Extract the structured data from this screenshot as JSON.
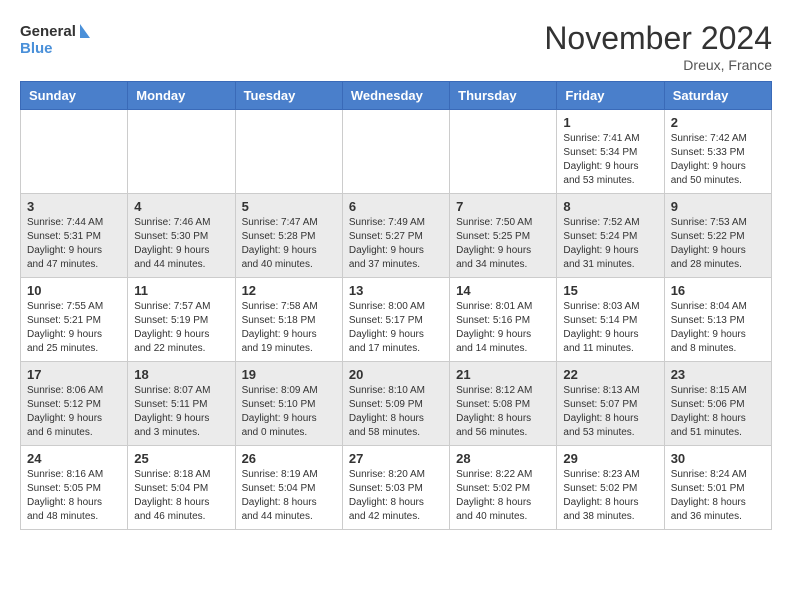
{
  "logo": {
    "line1": "General",
    "line2": "Blue"
  },
  "title": "November 2024",
  "location": "Dreux, France",
  "weekdays": [
    "Sunday",
    "Monday",
    "Tuesday",
    "Wednesday",
    "Thursday",
    "Friday",
    "Saturday"
  ],
  "weeks": [
    [
      {
        "day": "",
        "info": ""
      },
      {
        "day": "",
        "info": ""
      },
      {
        "day": "",
        "info": ""
      },
      {
        "day": "",
        "info": ""
      },
      {
        "day": "",
        "info": ""
      },
      {
        "day": "1",
        "info": "Sunrise: 7:41 AM\nSunset: 5:34 PM\nDaylight: 9 hours and 53 minutes."
      },
      {
        "day": "2",
        "info": "Sunrise: 7:42 AM\nSunset: 5:33 PM\nDaylight: 9 hours and 50 minutes."
      }
    ],
    [
      {
        "day": "3",
        "info": "Sunrise: 7:44 AM\nSunset: 5:31 PM\nDaylight: 9 hours and 47 minutes."
      },
      {
        "day": "4",
        "info": "Sunrise: 7:46 AM\nSunset: 5:30 PM\nDaylight: 9 hours and 44 minutes."
      },
      {
        "day": "5",
        "info": "Sunrise: 7:47 AM\nSunset: 5:28 PM\nDaylight: 9 hours and 40 minutes."
      },
      {
        "day": "6",
        "info": "Sunrise: 7:49 AM\nSunset: 5:27 PM\nDaylight: 9 hours and 37 minutes."
      },
      {
        "day": "7",
        "info": "Sunrise: 7:50 AM\nSunset: 5:25 PM\nDaylight: 9 hours and 34 minutes."
      },
      {
        "day": "8",
        "info": "Sunrise: 7:52 AM\nSunset: 5:24 PM\nDaylight: 9 hours and 31 minutes."
      },
      {
        "day": "9",
        "info": "Sunrise: 7:53 AM\nSunset: 5:22 PM\nDaylight: 9 hours and 28 minutes."
      }
    ],
    [
      {
        "day": "10",
        "info": "Sunrise: 7:55 AM\nSunset: 5:21 PM\nDaylight: 9 hours and 25 minutes."
      },
      {
        "day": "11",
        "info": "Sunrise: 7:57 AM\nSunset: 5:19 PM\nDaylight: 9 hours and 22 minutes."
      },
      {
        "day": "12",
        "info": "Sunrise: 7:58 AM\nSunset: 5:18 PM\nDaylight: 9 hours and 19 minutes."
      },
      {
        "day": "13",
        "info": "Sunrise: 8:00 AM\nSunset: 5:17 PM\nDaylight: 9 hours and 17 minutes."
      },
      {
        "day": "14",
        "info": "Sunrise: 8:01 AM\nSunset: 5:16 PM\nDaylight: 9 hours and 14 minutes."
      },
      {
        "day": "15",
        "info": "Sunrise: 8:03 AM\nSunset: 5:14 PM\nDaylight: 9 hours and 11 minutes."
      },
      {
        "day": "16",
        "info": "Sunrise: 8:04 AM\nSunset: 5:13 PM\nDaylight: 9 hours and 8 minutes."
      }
    ],
    [
      {
        "day": "17",
        "info": "Sunrise: 8:06 AM\nSunset: 5:12 PM\nDaylight: 9 hours and 6 minutes."
      },
      {
        "day": "18",
        "info": "Sunrise: 8:07 AM\nSunset: 5:11 PM\nDaylight: 9 hours and 3 minutes."
      },
      {
        "day": "19",
        "info": "Sunrise: 8:09 AM\nSunset: 5:10 PM\nDaylight: 9 hours and 0 minutes."
      },
      {
        "day": "20",
        "info": "Sunrise: 8:10 AM\nSunset: 5:09 PM\nDaylight: 8 hours and 58 minutes."
      },
      {
        "day": "21",
        "info": "Sunrise: 8:12 AM\nSunset: 5:08 PM\nDaylight: 8 hours and 56 minutes."
      },
      {
        "day": "22",
        "info": "Sunrise: 8:13 AM\nSunset: 5:07 PM\nDaylight: 8 hours and 53 minutes."
      },
      {
        "day": "23",
        "info": "Sunrise: 8:15 AM\nSunset: 5:06 PM\nDaylight: 8 hours and 51 minutes."
      }
    ],
    [
      {
        "day": "24",
        "info": "Sunrise: 8:16 AM\nSunset: 5:05 PM\nDaylight: 8 hours and 48 minutes."
      },
      {
        "day": "25",
        "info": "Sunrise: 8:18 AM\nSunset: 5:04 PM\nDaylight: 8 hours and 46 minutes."
      },
      {
        "day": "26",
        "info": "Sunrise: 8:19 AM\nSunset: 5:04 PM\nDaylight: 8 hours and 44 minutes."
      },
      {
        "day": "27",
        "info": "Sunrise: 8:20 AM\nSunset: 5:03 PM\nDaylight: 8 hours and 42 minutes."
      },
      {
        "day": "28",
        "info": "Sunrise: 8:22 AM\nSunset: 5:02 PM\nDaylight: 8 hours and 40 minutes."
      },
      {
        "day": "29",
        "info": "Sunrise: 8:23 AM\nSunset: 5:02 PM\nDaylight: 8 hours and 38 minutes."
      },
      {
        "day": "30",
        "info": "Sunrise: 8:24 AM\nSunset: 5:01 PM\nDaylight: 8 hours and 36 minutes."
      }
    ]
  ]
}
